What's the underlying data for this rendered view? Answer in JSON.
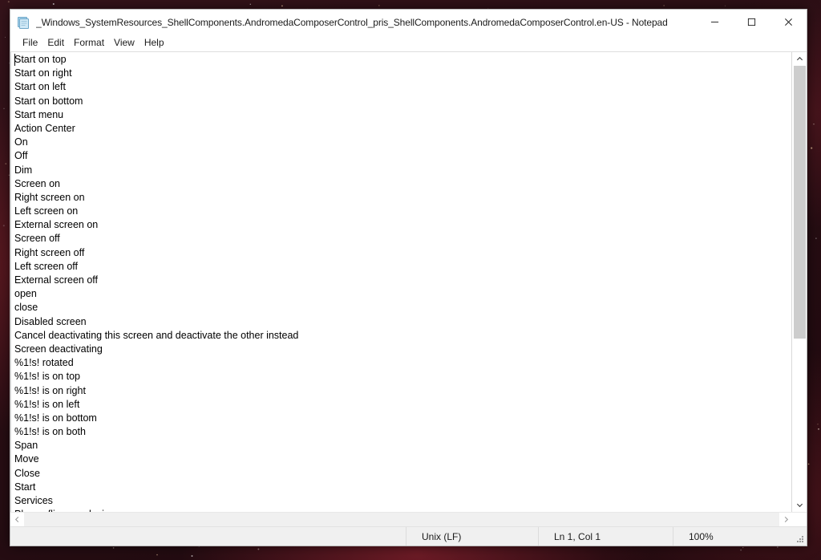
{
  "window": {
    "title": "_Windows_SystemResources_ShellComponents.AndromedaComposerControl_pris_ShellComponents.AndromedaComposerControl.en-US - Notepad",
    "app_icon": "notepad-icon",
    "controls": {
      "minimize": "−",
      "maximize": "□",
      "close": "✕"
    }
  },
  "menu": {
    "items": [
      {
        "label": "File"
      },
      {
        "label": "Edit"
      },
      {
        "label": "Format"
      },
      {
        "label": "View"
      },
      {
        "label": "Help"
      }
    ]
  },
  "editor": {
    "lines": [
      "Start on top",
      "Start on right",
      "Start on left",
      "Start on bottom",
      "Start menu",
      "Action Center",
      "On",
      "Off",
      "Dim",
      "Screen on",
      "Right screen on",
      "Left screen on",
      "External screen on",
      "Screen off",
      "Right screen off",
      "Left screen off",
      "External screen off",
      "open",
      "close",
      "Disabled screen",
      "Cancel deactivating this screen and deactivate the other instead",
      "Screen deactivating",
      "%1!s! rotated",
      "%1!s! is on top",
      "%1!s! is on right",
      "%1!s! is on left",
      "%1!s! is on bottom",
      "%1!s! is on both",
      "Span",
      "Move",
      "Close",
      "Start",
      "Services",
      "Please flip your device."
    ]
  },
  "scrollbars": {
    "vertical": {
      "up_arrow": "▲",
      "down_arrow": "▼",
      "thumb_top_pct": 0,
      "thumb_height_pct": 63
    },
    "horizontal": {
      "left_arrow": "◀",
      "right_arrow": "▶"
    }
  },
  "status_bar": {
    "encoding": "Unix (LF)",
    "position": "Ln 1, Col 1",
    "zoom": "100%",
    "resize_grip": "resize-grip-icon"
  },
  "colors": {
    "window_bg": "#ffffff",
    "text": "#000000",
    "status_bg": "#f0f0f0",
    "scroll_thumb": "#cdcdcd",
    "desktop": "#2a0f12"
  }
}
